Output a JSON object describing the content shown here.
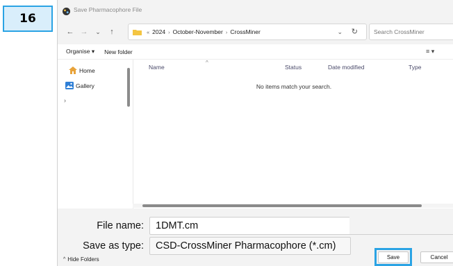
{
  "step_badge": "16",
  "window": {
    "title": "Save Pharmacophore File"
  },
  "nav": {
    "back": "←",
    "forward": "→",
    "recent": "⌄",
    "up": "↑",
    "breadcrumb": {
      "overflow": "«",
      "items": [
        "2024",
        "October-November",
        "CrossMiner"
      ],
      "separator": "›"
    },
    "address_dropdown": "⌄",
    "refresh": "↻",
    "search_placeholder": "Search CrossMiner"
  },
  "toolbar": {
    "organise_label": "Organise ▾",
    "new_folder_label": "New folder",
    "view_label": "≡ ▾"
  },
  "sidebar": {
    "items": [
      {
        "label": "Home",
        "icon": "home-icon"
      },
      {
        "label": "Gallery",
        "icon": "gallery-icon"
      }
    ],
    "expander": "›"
  },
  "filelist": {
    "columns": [
      "Name",
      "Status",
      "Date modified",
      "Type"
    ],
    "sort_indicator": "^",
    "empty_message": "No items match your search."
  },
  "form": {
    "file_name_label": "File name:",
    "file_name_value": "1DMT.cm",
    "save_type_label": "Save as type:",
    "save_type_value": "CSD-CrossMiner Pharmacophore (*.cm)",
    "hide_folders_label": "Hide Folders",
    "save_label": "Save",
    "cancel_label": "Cancel"
  },
  "colors": {
    "highlight": "#2aa3e4",
    "folder": "#f4c542",
    "home": "#e8a33a",
    "gallery": "#2f7fd6"
  }
}
